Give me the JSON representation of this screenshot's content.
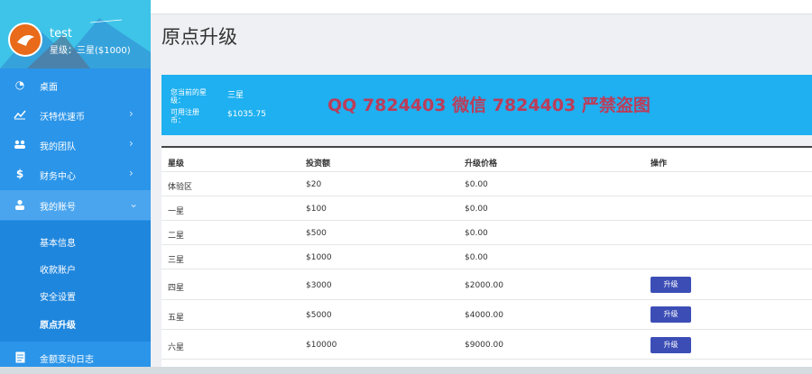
{
  "profile": {
    "username": "test",
    "level_text": "星级：三星($1000)"
  },
  "sidebar": {
    "items": [
      {
        "label": "桌面",
        "icon": "dashboard-icon"
      },
      {
        "label": "沃特优速币",
        "icon": "chart-icon"
      },
      {
        "label": "我的团队",
        "icon": "team-icon"
      },
      {
        "label": "财务中心",
        "icon": "dollar-icon"
      },
      {
        "label": "我的账号",
        "icon": "user-icon"
      }
    ],
    "submenu": [
      {
        "label": "基本信息"
      },
      {
        "label": "收款账户"
      },
      {
        "label": "安全设置"
      },
      {
        "label": "原点升级"
      }
    ],
    "bottom_item": {
      "label": "金额变动日志",
      "icon": "document-icon"
    }
  },
  "page": {
    "title": "原点升级"
  },
  "info": {
    "current_level_label": "您当前的星级：",
    "current_level_value": "三星",
    "available_label": "可用注册币：",
    "available_value": "$1035.75",
    "watermark": "QQ 7824403  微信 7824403 严禁盗图"
  },
  "table": {
    "headers": [
      "星级",
      "投资额",
      "升级价格",
      "操作"
    ],
    "rows": [
      {
        "level": "体验区",
        "investment": "$20",
        "price": "$0.00",
        "action": ""
      },
      {
        "level": "一星",
        "investment": "$100",
        "price": "$0.00",
        "action": ""
      },
      {
        "level": "二星",
        "investment": "$500",
        "price": "$0.00",
        "action": ""
      },
      {
        "level": "三星",
        "investment": "$1000",
        "price": "$0.00",
        "action": ""
      },
      {
        "level": "四星",
        "investment": "$3000",
        "price": "$2000.00",
        "action": "升级"
      },
      {
        "level": "五星",
        "investment": "$5000",
        "price": "$4000.00",
        "action": "升级"
      },
      {
        "level": "六星",
        "investment": "$10000",
        "price": "$9000.00",
        "action": "升级"
      }
    ]
  },
  "colors": {
    "sidebar": "#2b95e9",
    "info_panel": "#1eb0f0",
    "button": "#3c4eb6",
    "watermark": "#c8344e"
  }
}
